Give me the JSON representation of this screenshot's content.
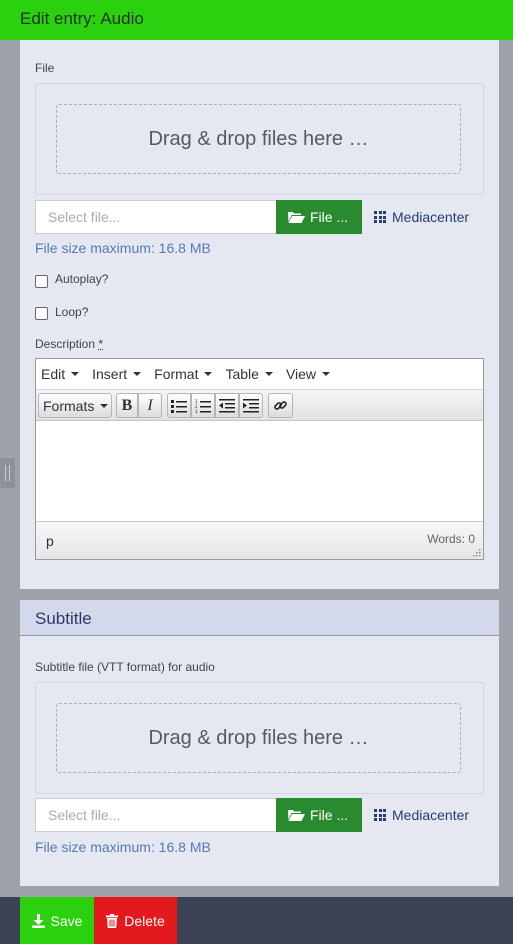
{
  "header": {
    "title": "Edit entry: Audio"
  },
  "audio_file": {
    "label": "File",
    "dropzone_text": "Drag & drop files here …",
    "input_placeholder": "Select file...",
    "file_button": "File ...",
    "mediacenter_button": "Mediacenter",
    "size_note": "File size maximum: 16.8 MB"
  },
  "options": {
    "autoplay_label": "Autoplay?",
    "autoplay_checked": false,
    "loop_label": "Loop?",
    "loop_checked": false
  },
  "description": {
    "label": "Description",
    "required_mark": "*",
    "menus": [
      "Edit",
      "Insert",
      "Format",
      "Table",
      "View"
    ],
    "formats_dropdown": "Formats",
    "bold_label": "B",
    "italic_label": "I",
    "status_path": "p",
    "word_count": "Words: 0"
  },
  "subtitle": {
    "section_title": "Subtitle",
    "label": "Subtitle file (VTT format) for audio",
    "dropzone_text": "Drag & drop files here …",
    "input_placeholder": "Select file...",
    "file_button": "File ...",
    "mediacenter_button": "Mediacenter",
    "size_note": "File size maximum: 16.8 MB"
  },
  "footer": {
    "save_label": "Save",
    "delete_label": "Delete"
  },
  "colors": {
    "accent_green": "#2bd10e",
    "file_button": "#2a8a2f",
    "delete_red": "#e4191d",
    "link_blue": "#5779b8"
  }
}
